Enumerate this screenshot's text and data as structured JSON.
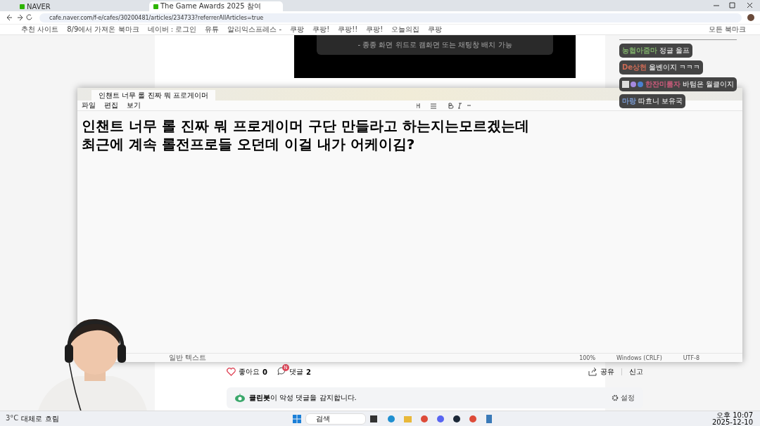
{
  "browser": {
    "tabs": [
      {
        "title": "NAVER",
        "selected": false
      },
      {
        "title": "The Game Awards 2025 참여",
        "selected": true
      }
    ],
    "url": "cafe.naver.com/f-e/cafes/30200481/articles/234733?referrerAllArticles=true",
    "bookmarks": [
      "추천 사이트",
      "8/9에서 가져온 북마크",
      "네이버 : 로그인",
      "유튜",
      "알리익스프레스 -",
      "쿠팡",
      "쿠팡!",
      "쿠팡!!",
      "쿠팡!",
      "오늘의집",
      "쿠팡"
    ],
    "all_bookmarks": "모든 북마크"
  },
  "video": {
    "caption": "- 종종 화면 위드로 캠화면 또는 채팅창 배치 가능"
  },
  "chat": [
    {
      "name": "농협아줌마",
      "color": "#7fae6a",
      "message": "정글 울프",
      "badges": false
    },
    {
      "name": "De상현",
      "color": "#c86a55",
      "message": "울볜이지 ㅋㅋㅋ",
      "badges": false
    },
    {
      "name": "한잔미룸자",
      "color": "#c85a7a",
      "message": "바텀은 월클이지",
      "badges": true
    },
    {
      "name": "마랑",
      "color": "#7a9ad0",
      "message": "따효니 보유국",
      "badges": false
    }
  ],
  "notepad": {
    "tab_title": "인챈트 너무 롤 진짜 뭐 프로게이머",
    "menu": [
      "파일",
      "편집",
      "보기"
    ],
    "lines": [
      "인챈트 너무 롤 진짜 뭐 프로게이머 구단 만들라고 하는지는모르겠는데",
      "최근에 계속 롤전프로들 오던데 이걸 내가 어케이김?"
    ],
    "status": [
      "일반 텍스트",
      "100%",
      "Windows (CRLF)",
      "UTF-8"
    ]
  },
  "article": {
    "like_label": "좋아요",
    "like_count": "0",
    "comment_label": "댓글",
    "comment_badge": "N",
    "comment_count": "2",
    "share": "공유",
    "report": "신고",
    "cleanbot": "**클린봇**이 악성 댓글을 감지합니다.",
    "settings": "설정"
  },
  "taskbar": {
    "temperature": "3°C",
    "weather": "대체로 흐림",
    "search": "검색",
    "time": "오후 10:07",
    "date": "2025-12-10"
  }
}
